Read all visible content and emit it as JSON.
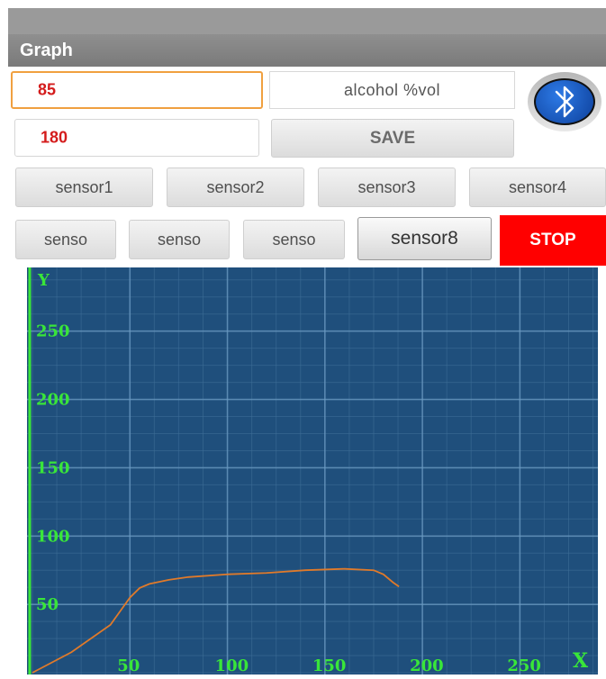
{
  "titlebar": {
    "title": "Graph"
  },
  "inputs": {
    "value_a": "85",
    "value_b": "180"
  },
  "measure_label": "alcohol  %vol",
  "save_label": "SAVE",
  "sensors_row1": [
    "sensor1",
    "sensor2",
    "sensor3",
    "sensor4"
  ],
  "sensors_row2": [
    "senso",
    "senso",
    "senso",
    "sensor8"
  ],
  "stop_label": "STOP",
  "icons": {
    "bluetooth": "bluetooth-icon"
  },
  "colors": {
    "graph_bg": "#1f4f7c",
    "axis_green": "#39e639",
    "trace": "#e07a2a",
    "stop": "#ff0000",
    "value_text": "#d41c1c"
  },
  "chart_data": {
    "type": "line",
    "title": "",
    "xlabel": "X",
    "ylabel": "Y",
    "xlim": [
      0,
      290
    ],
    "ylim": [
      0,
      290
    ],
    "xticks": [
      50,
      100,
      150,
      200,
      250
    ],
    "yticks": [
      50,
      100,
      150,
      200,
      250
    ],
    "grid": true,
    "series": [
      {
        "x": [
          0,
          20,
          40,
          50,
          55,
          60,
          70,
          80,
          100,
          120,
          140,
          160,
          175,
          180,
          185,
          188
        ],
        "y": [
          0,
          15,
          35,
          55,
          62,
          65,
          68,
          70,
          72,
          73,
          75,
          76,
          75,
          72,
          66,
          63
        ]
      }
    ]
  }
}
